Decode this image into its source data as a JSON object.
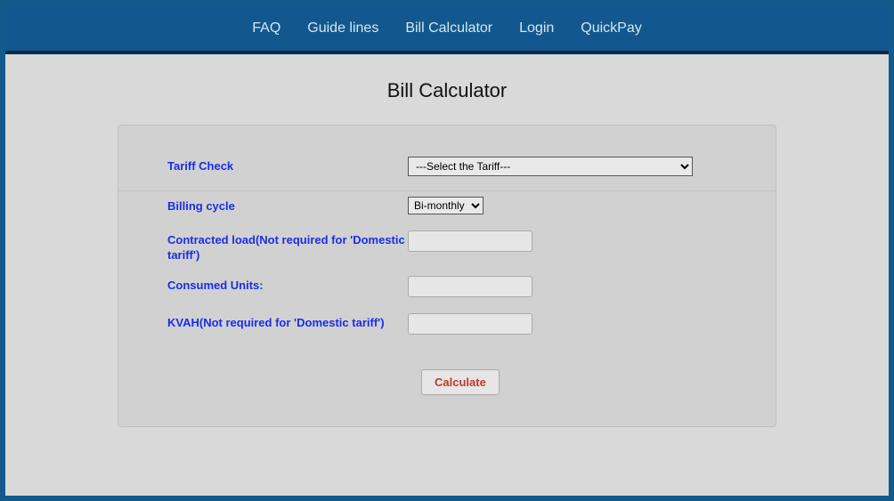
{
  "nav": {
    "faq": "FAQ",
    "guidelines": "Guide lines",
    "billcalc": "Bill Calculator",
    "login": "Login",
    "quickpay": "QuickPay"
  },
  "page": {
    "title": "Bill Calculator"
  },
  "form": {
    "tariff_label": "Tariff Check",
    "tariff_selected": "---Select the Tariff---",
    "billing_cycle_label": "Billing cycle",
    "billing_cycle_selected": "Bi-monthly",
    "contracted_load_label": "Contracted load(Not required for 'Domestic tariff')",
    "contracted_load_value": "",
    "consumed_units_label": "Consumed Units:",
    "consumed_units_value": "",
    "kvah_label": "KVAH(Not required for 'Domestic tariff')",
    "kvah_value": "",
    "calculate_label": "Calculate"
  }
}
